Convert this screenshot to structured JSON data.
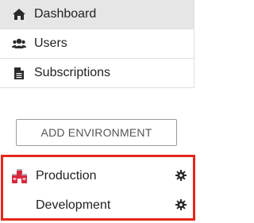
{
  "nav": {
    "items": [
      {
        "label": "Dashboard",
        "icon": "home-icon",
        "active": true
      },
      {
        "label": "Users",
        "icon": "users-icon",
        "active": false
      },
      {
        "label": "Subscriptions",
        "icon": "file-icon",
        "active": false
      }
    ]
  },
  "add_environment": {
    "label": "ADD ENVIRONMENT"
  },
  "environments": {
    "items": [
      {
        "label": "Production",
        "icon": "production-cans-icon"
      },
      {
        "label": "Development",
        "icon": ""
      }
    ],
    "highlight_color": "#e5261b"
  }
}
